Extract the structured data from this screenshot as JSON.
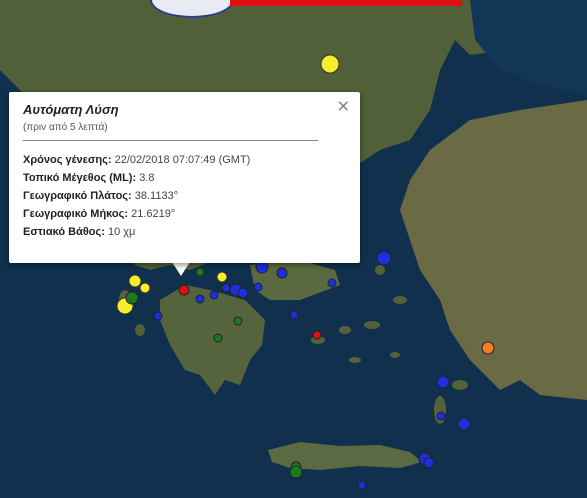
{
  "popup": {
    "title": "Αυτόματη Λύση",
    "subtitle": "(πριν από 5 λεπτά)",
    "close_symbol": "×",
    "rows": [
      {
        "label": "Χρόνος γένεσης:",
        "value": "22/02/2018  07:07:49 (GMT)"
      },
      {
        "label": "Τοπικό Μέγεθος (ML):",
        "value": "3.8"
      },
      {
        "label": "Γεωγραφικό Πλάτος:",
        "value": "38.1133°"
      },
      {
        "label": "Γεωγραφικό Μήκος:",
        "value": "21.6219°"
      },
      {
        "label": "Εστιακό Βάθος:",
        "value": "10 χμ"
      }
    ]
  },
  "colors": {
    "sea": "#0f2a44",
    "land": "#4f5d38",
    "marker_red": "#e01010",
    "marker_yellow": "#f5ee2a",
    "marker_blue": "#1a2fe0",
    "marker_green": "#1d7a1d",
    "marker_orange": "#f08020"
  },
  "icons": [
    "close-icon",
    "observatory-logo"
  ]
}
